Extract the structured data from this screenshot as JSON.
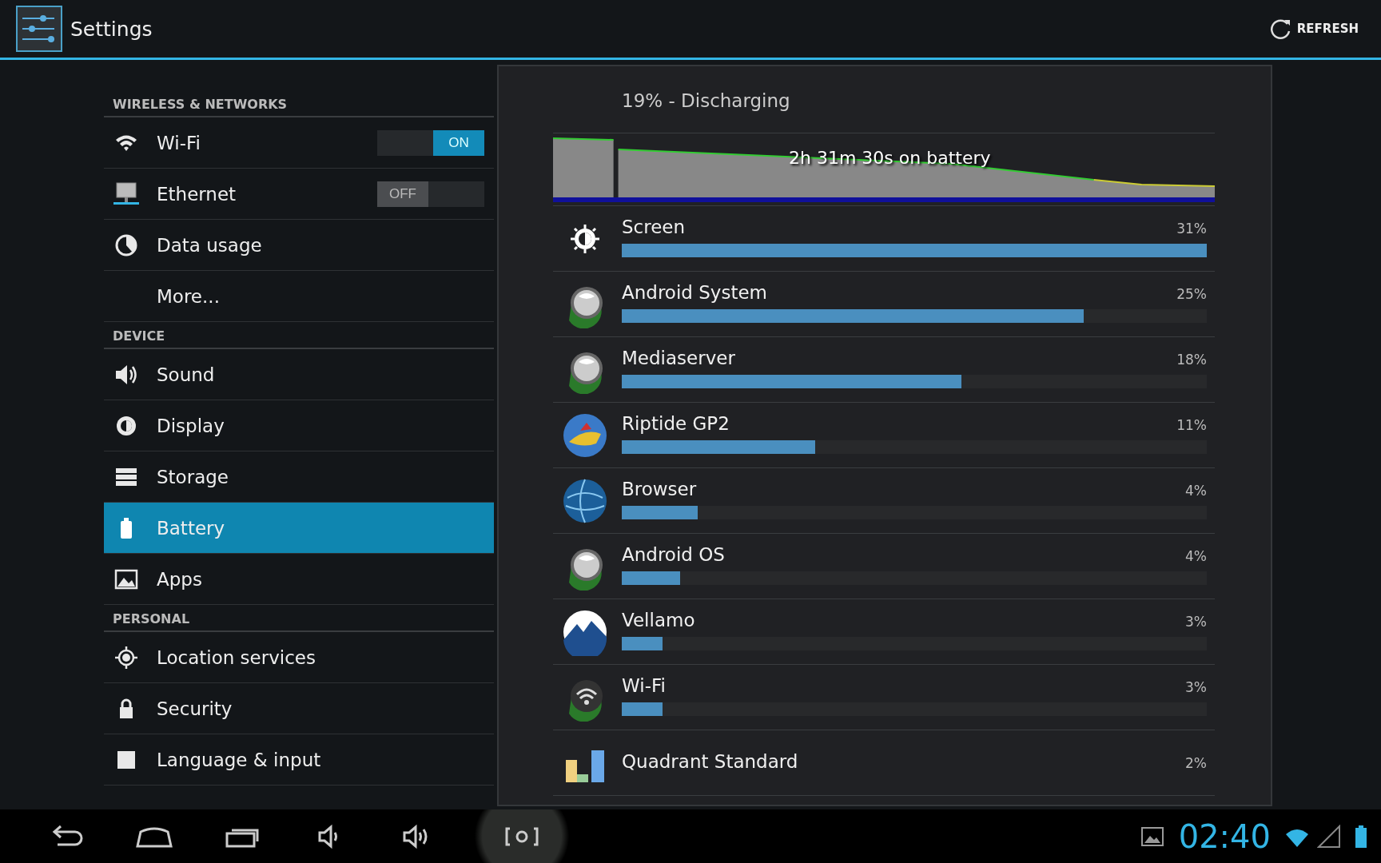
{
  "action_bar": {
    "title": "Settings",
    "refresh_button": "REFRESH"
  },
  "sidebar": {
    "sections": [
      {
        "header": "WIRELESS & NETWORKS",
        "items": [
          {
            "kind": "wifi",
            "label": "Wi-Fi",
            "selected": false,
            "toggle": {
              "on": true,
              "label": "ON"
            }
          },
          {
            "kind": "ethernet",
            "label": "Ethernet",
            "selected": false,
            "toggle": {
              "on": false,
              "label": "OFF"
            }
          },
          {
            "kind": "data",
            "label": "Data usage",
            "selected": false
          },
          {
            "kind": "plain",
            "label": "More...",
            "selected": false
          }
        ]
      },
      {
        "header": "DEVICE",
        "items": [
          {
            "kind": "sound",
            "label": "Sound",
            "selected": false
          },
          {
            "kind": "display",
            "label": "Display",
            "selected": false
          },
          {
            "kind": "storage",
            "label": "Storage",
            "selected": false
          },
          {
            "kind": "battery",
            "label": "Battery",
            "selected": true
          },
          {
            "kind": "apps",
            "label": "Apps",
            "selected": false
          }
        ]
      },
      {
        "header": "PERSONAL",
        "items": [
          {
            "kind": "location",
            "label": "Location services",
            "selected": false
          },
          {
            "kind": "security",
            "label": "Security",
            "selected": false
          },
          {
            "kind": "language",
            "label": "Language & input",
            "selected": false
          }
        ]
      }
    ]
  },
  "battery": {
    "status": "19% - Discharging",
    "graph_label": "2h 31m 30s on battery",
    "apps": [
      {
        "kind": "brightness",
        "name": "Screen",
        "percent": "31%",
        "level": 1.0
      },
      {
        "kind": "system",
        "name": "Android System",
        "percent": "25%",
        "level": 0.79
      },
      {
        "kind": "system",
        "name": "Mediaserver",
        "percent": "18%",
        "level": 0.58
      },
      {
        "kind": "game",
        "name": "Riptide GP2",
        "percent": "11%",
        "level": 0.33
      },
      {
        "kind": "globe",
        "name": "Browser",
        "percent": "4%",
        "level": 0.13
      },
      {
        "kind": "system",
        "name": "Android OS",
        "percent": "4%",
        "level": 0.1
      },
      {
        "kind": "mountain",
        "name": "Vellamo",
        "percent": "3%",
        "level": 0.07
      },
      {
        "kind": "wifi",
        "name": "Wi-Fi",
        "percent": "3%",
        "level": 0.07
      },
      {
        "kind": "chart",
        "name": "Quadrant Standard",
        "percent": "2%"
      }
    ]
  },
  "nav_bar": {
    "time": "02:40"
  }
}
